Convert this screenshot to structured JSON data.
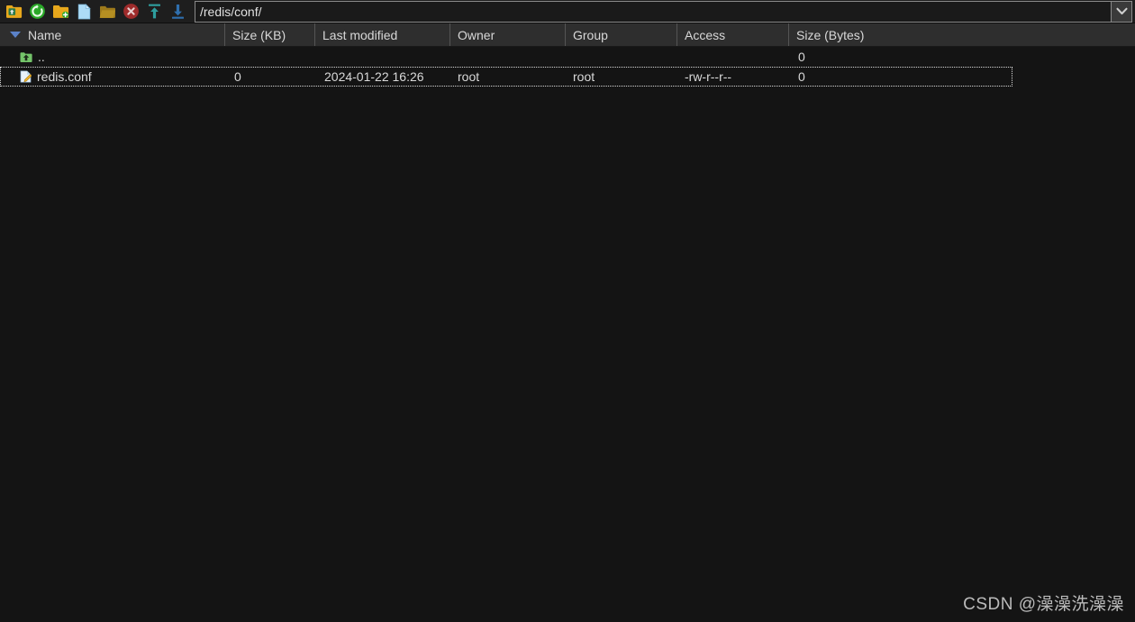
{
  "toolbar": {
    "buttons": [
      {
        "name": "parent-directory-button",
        "icon": "folder-up-icon",
        "title": "Parent Directory"
      },
      {
        "name": "refresh-button",
        "icon": "refresh-icon",
        "title": "Refresh"
      },
      {
        "name": "new-folder-button",
        "icon": "folder-add-icon",
        "title": "New Folder"
      },
      {
        "name": "new-file-button",
        "icon": "new-file-icon",
        "title": "New File"
      },
      {
        "name": "open-folder-button",
        "icon": "folder-open-icon",
        "title": "Open"
      },
      {
        "name": "delete-button",
        "icon": "delete-circle-icon",
        "title": "Delete"
      },
      {
        "name": "upload-button",
        "icon": "upload-arrow-icon",
        "title": "Upload"
      },
      {
        "name": "download-button",
        "icon": "download-arrow-icon",
        "title": "Download"
      }
    ],
    "path_value": "/redis/conf/",
    "path_placeholder": "/",
    "dropdown_icon": "chevron-down-icon"
  },
  "columns": [
    {
      "key": "name",
      "label": "Name",
      "sorted": true,
      "sort_dir": "desc"
    },
    {
      "key": "kb",
      "label": "Size (KB)",
      "sorted": false
    },
    {
      "key": "mod",
      "label": "Last modified",
      "sorted": false
    },
    {
      "key": "owner",
      "label": "Owner",
      "sorted": false
    },
    {
      "key": "group",
      "label": "Group",
      "sorted": false
    },
    {
      "key": "acc",
      "label": "Access",
      "sorted": false
    },
    {
      "key": "bytes",
      "label": "Size (Bytes)",
      "sorted": false
    }
  ],
  "rows": [
    {
      "name": "..",
      "icon": "folder-up-green-icon",
      "kb": "",
      "mod": "",
      "owner": "",
      "group": "",
      "access": "",
      "bytes": "0",
      "selected": false
    },
    {
      "name": "redis.conf",
      "icon": "file-edit-icon",
      "kb": "0",
      "mod": "2024-01-22 16:26",
      "owner": "root",
      "group": "root",
      "access": "-rw-r--r--",
      "bytes": "0",
      "selected": true
    }
  ],
  "watermark": {
    "text": "CSDN @澡澡洗澡澡"
  },
  "colors": {
    "toolbar_bg": "#1e1e1e",
    "header_bg": "#2e2e2e",
    "list_bg": "#141414",
    "text": "#d9d9d9",
    "sort_caret": "#5b82c8",
    "accent_green": "#2aa828",
    "accent_gold": "#e8a81c",
    "accent_red": "#9e2b2b"
  }
}
